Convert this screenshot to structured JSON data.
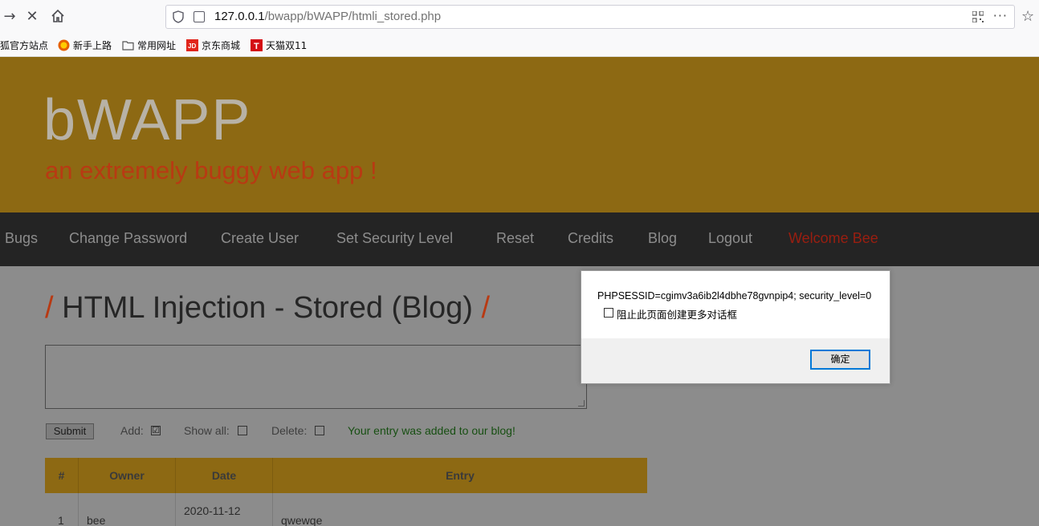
{
  "browser": {
    "url_host": "127.0.0.1",
    "url_path": "/bwapp/bWAPP/htmli_stored.php",
    "bookmarks": [
      "狐官方站点",
      "新手上路",
      "常用网址",
      "京东商城",
      "天猫双11"
    ]
  },
  "site": {
    "logo": "bWAPP",
    "tagline": "an extremely buggy web app !"
  },
  "menu": {
    "items": [
      "Bugs",
      "Change Password",
      "Create User",
      "Set Security Level",
      "Reset",
      "Credits",
      "Blog",
      "Logout"
    ],
    "welcome": "Welcome Bee"
  },
  "page": {
    "slash": "/",
    "title": "HTML Injection - Stored (Blog)",
    "submit_label": "Submit",
    "add_label": "Add:",
    "add_checked_mark": "☑",
    "show_all_label": "Show all:",
    "delete_label": "Delete:",
    "notice": "Your entry was added to our blog!"
  },
  "table": {
    "headers": [
      "#",
      "Owner",
      "Date",
      "Entry"
    ],
    "rows": [
      {
        "num": "1",
        "owner": "bee",
        "date": "2020-11-12",
        "entry": "qwewqe"
      }
    ]
  },
  "dialog": {
    "message": "PHPSESSID=cgimv3a6ib2l4dbhe78gvnpip4; security_level=0",
    "checkbox_label": "阻止此页面创建更多对话框",
    "ok_label": "确定"
  },
  "colors": {
    "header_bg": "#8d6913",
    "tagline": "#b83a13",
    "welcome": "#9a1e10",
    "notice": "#174f12",
    "dialog_focus": "#0078d7"
  }
}
